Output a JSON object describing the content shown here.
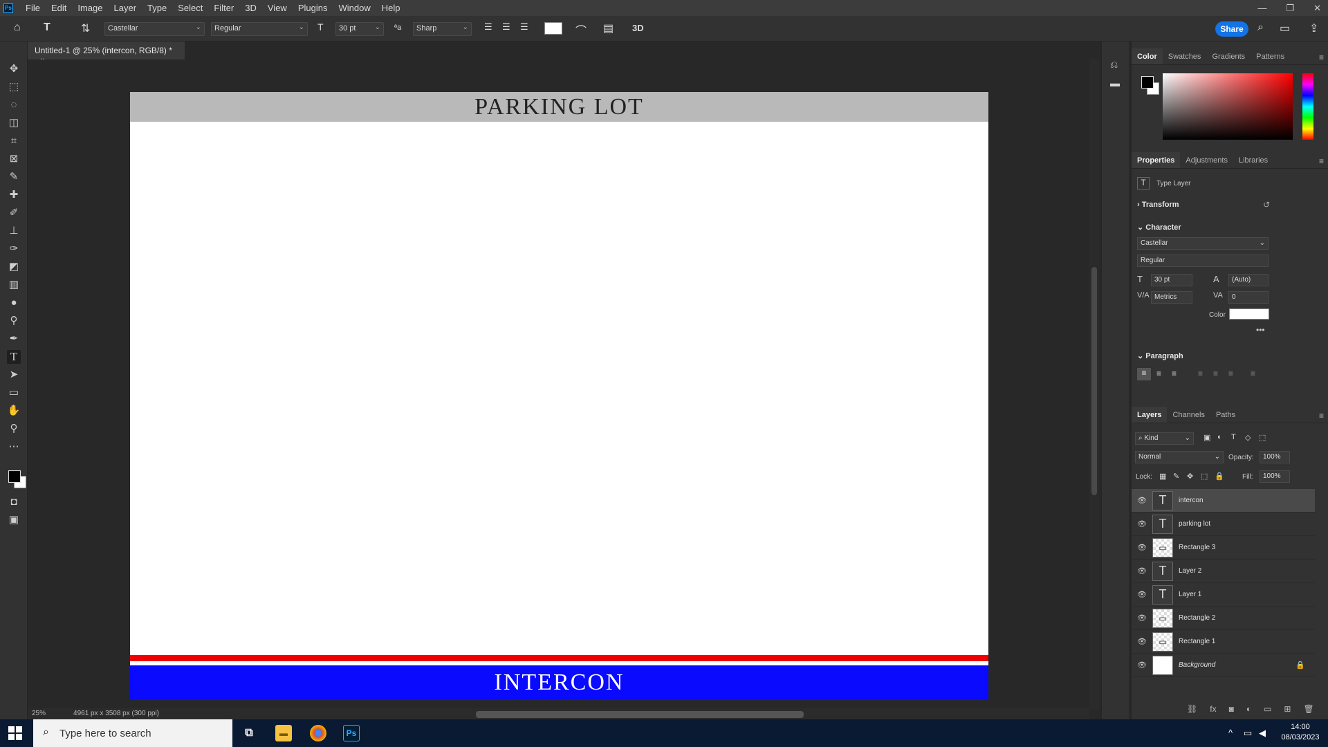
{
  "menu": {
    "items": [
      "File",
      "Edit",
      "Image",
      "Layer",
      "Type",
      "Select",
      "Filter",
      "3D",
      "View",
      "Plugins",
      "Window",
      "Help"
    ],
    "logo": "Ps"
  },
  "window_controls": {
    "minimize": "—",
    "restore": "❐",
    "close": "✕"
  },
  "options": {
    "font_family": "Castellar",
    "font_style": "Regular",
    "font_size": "30 pt",
    "antialias": "Sharp",
    "three_d": "3D",
    "share": "Share"
  },
  "document": {
    "tab_title": "Untitled-1 @ 25% (intercon, RGB/8) *",
    "top_banner_text": "PARKING LOT",
    "bottom_banner_text": "INTERCON",
    "colors": {
      "banner_gray": "#b9b9b9",
      "stripe_red": "#ee0000",
      "stripe_blue": "#0a0aff"
    }
  },
  "status": {
    "zoom": "25%",
    "doc_info": "4961 px x 3508 px (300 ppi)"
  },
  "color_panel": {
    "tabs": [
      "Color",
      "Swatches",
      "Gradients",
      "Patterns"
    ],
    "active_tab": "Color"
  },
  "properties_panel": {
    "tabs": [
      "Properties",
      "Adjustments",
      "Libraries"
    ],
    "layer_type": "Type Layer",
    "transform_label": "Transform",
    "character_label": "Character",
    "font_family": "Castellar",
    "font_style": "Regular",
    "font_size": "30 pt",
    "leading": "(Auto)",
    "kerning": "Metrics",
    "tracking": "0",
    "color_label": "Color",
    "more": "•••",
    "paragraph_label": "Paragraph"
  },
  "layers_panel": {
    "tabs": [
      "Layers",
      "Channels",
      "Paths"
    ],
    "filter_kind": "Kind",
    "blend_mode": "Normal",
    "opacity_label": "Opacity:",
    "opacity": "100%",
    "lock_label": "Lock:",
    "fill_label": "Fill:",
    "fill": "100%",
    "layers": [
      {
        "name": "intercon",
        "type": "text",
        "selected": true
      },
      {
        "name": "parking lot",
        "type": "text",
        "selected": false
      },
      {
        "name": "Rectangle 3",
        "type": "shape",
        "selected": false
      },
      {
        "name": "Layer 2",
        "type": "text",
        "selected": false
      },
      {
        "name": "Layer 1",
        "type": "text",
        "selected": false
      },
      {
        "name": "Rectangle 2",
        "type": "shape",
        "selected": false
      },
      {
        "name": "Rectangle 1",
        "type": "shape",
        "selected": false
      },
      {
        "name": "Background",
        "type": "background",
        "selected": false
      }
    ]
  },
  "taskbar": {
    "search_placeholder": "Type here to search",
    "time": "14:00",
    "date": "08/03/2023"
  }
}
